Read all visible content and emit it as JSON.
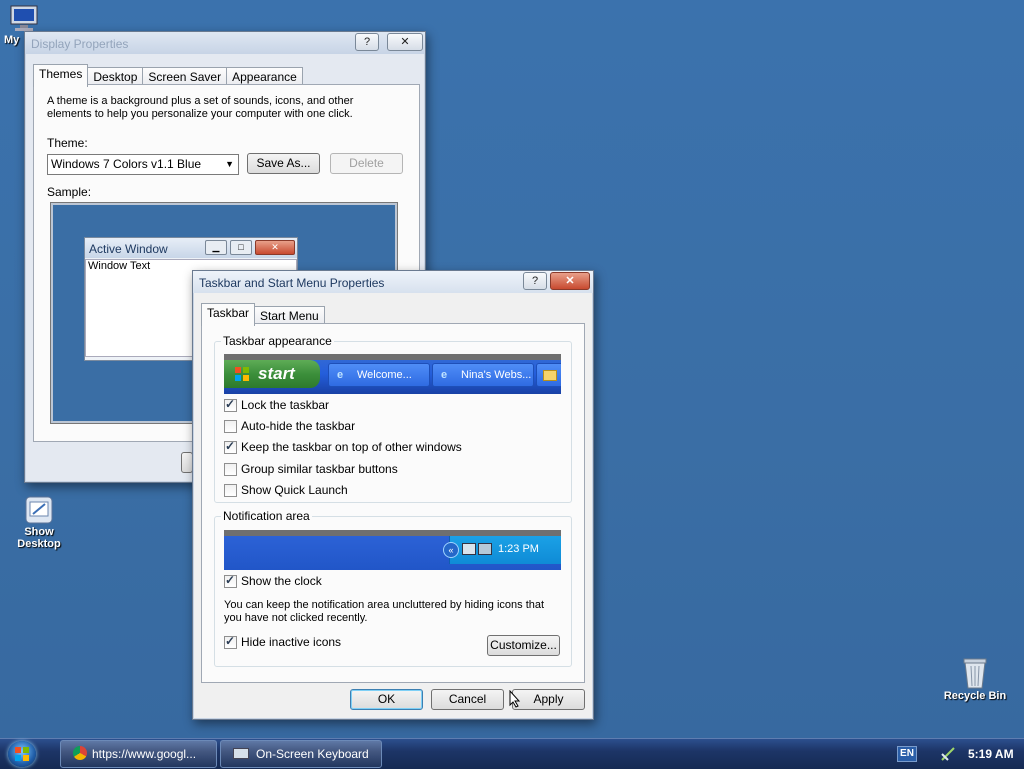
{
  "desktop": {
    "icons": [
      {
        "label": "My",
        "icon": "computer-icon"
      },
      {
        "label": "Show Desktop",
        "icon": "show-desktop-icon"
      },
      {
        "label": "Recycle Bin",
        "icon": "recycle-bin-icon"
      }
    ]
  },
  "display_properties": {
    "title": "Display Properties",
    "tabs": [
      "Themes",
      "Desktop",
      "Screen Saver",
      "Appearance"
    ],
    "description": "A theme is a background plus a set of sounds, icons, and other elements to help you personalize your computer with one click.",
    "theme_label": "Theme:",
    "theme_value": "Windows 7 Colors v1.1 Blue",
    "save_as": "Save As...",
    "delete": "Delete",
    "sample_label": "Sample:",
    "sample_window_title": "Active Window",
    "sample_window_text": "Window Text"
  },
  "taskbar_props": {
    "title": "Taskbar and Start Menu Properties",
    "tabs": [
      "Taskbar",
      "Start Menu"
    ],
    "appearance_group": "Taskbar appearance",
    "preview": {
      "start": "start",
      "btn1": "Welcome...",
      "btn2": "Nina's Webs..."
    },
    "options": [
      {
        "label": "Lock the taskbar",
        "checked": true
      },
      {
        "label": "Auto-hide the taskbar",
        "checked": false
      },
      {
        "label": "Keep the taskbar on top of other windows",
        "checked": true
      },
      {
        "label": "Group similar taskbar buttons",
        "checked": false
      },
      {
        "label": "Show Quick Launch",
        "checked": false
      }
    ],
    "notification_group": "Notification area",
    "tray_time": "1:23 PM",
    "show_clock": "Show the clock",
    "notification_text": "You can keep the notification area uncluttered by hiding icons that you have not clicked recently.",
    "hide_inactive": "Hide inactive icons",
    "customize": "Customize...",
    "ok": "OK",
    "cancel": "Cancel",
    "apply": "Apply"
  },
  "taskbar": {
    "items": [
      {
        "label": "https://www.googl...",
        "icon": "chrome-icon"
      },
      {
        "label": "On-Screen Keyboard",
        "icon": "keyboard-icon"
      }
    ],
    "language": "EN",
    "clock": "5:19 AM"
  }
}
